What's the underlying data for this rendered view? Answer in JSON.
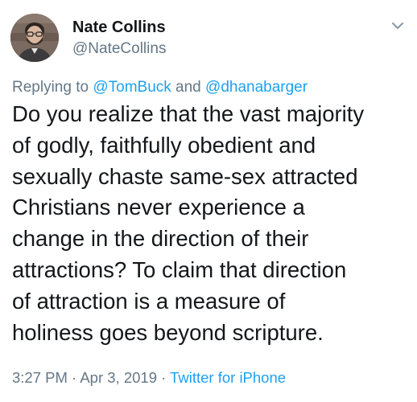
{
  "user": {
    "display_name": "Nate Collins",
    "handle": "@NateCollins"
  },
  "reply": {
    "prefix": "Replying to ",
    "mention1": "@TomBuck",
    "joiner": " and ",
    "mention2": "@dhanabarger"
  },
  "tweet": {
    "lines": [
      "Do you realize that the vast majority",
      "of godly, faithfully obedient and",
      "sexually chaste same-sex attracted",
      "Christians never experience a",
      "change in the direction of their",
      "attractions? To claim that direction",
      "of attraction is a measure of",
      "holiness goes beyond scripture."
    ]
  },
  "meta": {
    "time": "3:27 PM",
    "separator": " · ",
    "date": "Apr 3, 2019",
    "source": "Twitter for iPhone"
  },
  "colors": {
    "link": "#1da1f2",
    "secondary": "#657786",
    "text": "#14171a"
  },
  "icons": {
    "menu": "chevron-down-icon",
    "avatar": "user-avatar"
  }
}
